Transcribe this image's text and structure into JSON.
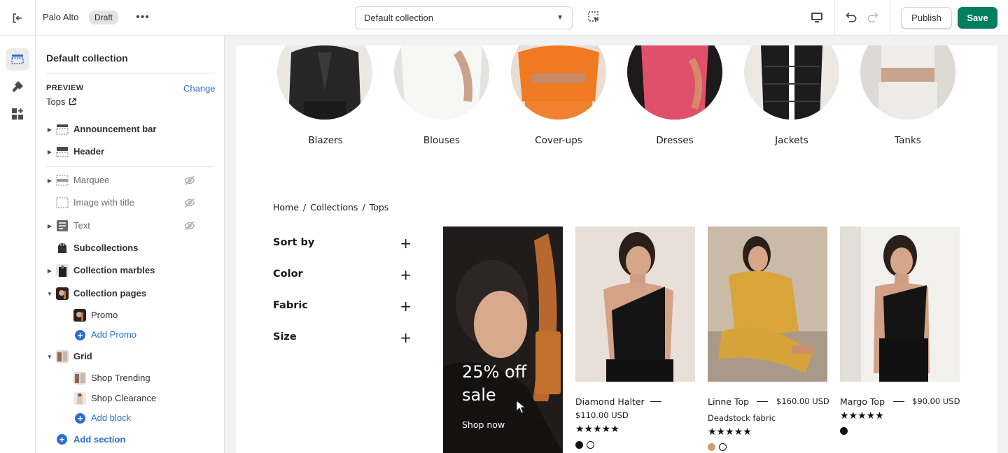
{
  "topbar": {
    "store_name": "Palo Alto",
    "status_badge": "Draft",
    "more_label": "•••",
    "template_select": "Default collection",
    "publish_label": "Publish",
    "save_label": "Save",
    "save_color": "#008060"
  },
  "rail": {
    "items": [
      {
        "icon": "sections-icon",
        "active": true
      },
      {
        "icon": "theme-settings-icon",
        "active": false
      },
      {
        "icon": "apps-icon",
        "active": false
      }
    ]
  },
  "sidebar": {
    "title": "Default collection",
    "preview_label": "PREVIEW",
    "change_label": "Change",
    "preview_value": "Tops",
    "sections": [
      {
        "label": "Announcement bar",
        "icon": "announcement-bar-icon",
        "expandable": true,
        "hidden": false
      },
      {
        "label": "Header",
        "icon": "header-icon",
        "expandable": true,
        "hidden": false
      },
      {
        "label": "Marquee",
        "icon": "marquee-icon",
        "expandable": true,
        "hidden": true
      },
      {
        "label": "Image with title",
        "icon": "image-with-title-icon",
        "expandable": false,
        "hidden": true
      },
      {
        "label": "Text",
        "icon": "text-icon",
        "expandable": true,
        "hidden": true
      },
      {
        "label": "Subcollections",
        "icon": "subcollections-icon",
        "expandable": false,
        "hidden": false
      },
      {
        "label": "Collection marbles",
        "icon": "collection-marbles-icon",
        "expandable": true,
        "hidden": false
      },
      {
        "label": "Collection pages",
        "icon": "collection-pages-icon",
        "expandable": true,
        "expanded": true,
        "hidden": false
      },
      {
        "label": "Promo",
        "icon": "promo-thumb-icon",
        "child": true
      },
      {
        "label": "Add Promo",
        "icon": "add-icon",
        "child": true,
        "add": true
      },
      {
        "label": "Grid",
        "icon": "grid-icon",
        "expandable": true,
        "expanded": true,
        "hidden": false
      },
      {
        "label": "Shop Trending",
        "icon": "shop-trending-thumb-icon",
        "child": true
      },
      {
        "label": "Shop Clearance",
        "icon": "shop-clearance-thumb-icon",
        "child": true
      },
      {
        "label": "Add block",
        "icon": "add-icon",
        "child": true,
        "add": true
      }
    ],
    "add_section_label": "Add section",
    "link_color": "#2c6ecb"
  },
  "preview": {
    "marbles": [
      {
        "label": "Blazers"
      },
      {
        "label": "Blouses"
      },
      {
        "label": "Cover-ups"
      },
      {
        "label": "Dresses"
      },
      {
        "label": "Jackets"
      },
      {
        "label": "Tanks"
      }
    ],
    "breadcrumb": [
      "Home",
      "/",
      "Collections",
      "/",
      "Tops"
    ],
    "filters": [
      "Sort by",
      "Color",
      "Fabric",
      "Size"
    ],
    "promo": {
      "title": "25% off sale",
      "cta": "Shop now"
    },
    "products": [
      {
        "name": "Diamond Halter",
        "price": "$110.00 USD",
        "note": "",
        "rating": 5,
        "swatches": [
          "#111111",
          "#ffffff"
        ]
      },
      {
        "name": "Linne Top",
        "price": "$160.00 USD",
        "note": "Deadstock fabric",
        "rating": 5,
        "swatches": [
          "#c9a26a",
          "#ffffff"
        ]
      },
      {
        "name": "Margo Top",
        "price": "$90.00 USD",
        "note": "",
        "rating": 5,
        "swatches": [
          "#111111"
        ]
      }
    ]
  }
}
